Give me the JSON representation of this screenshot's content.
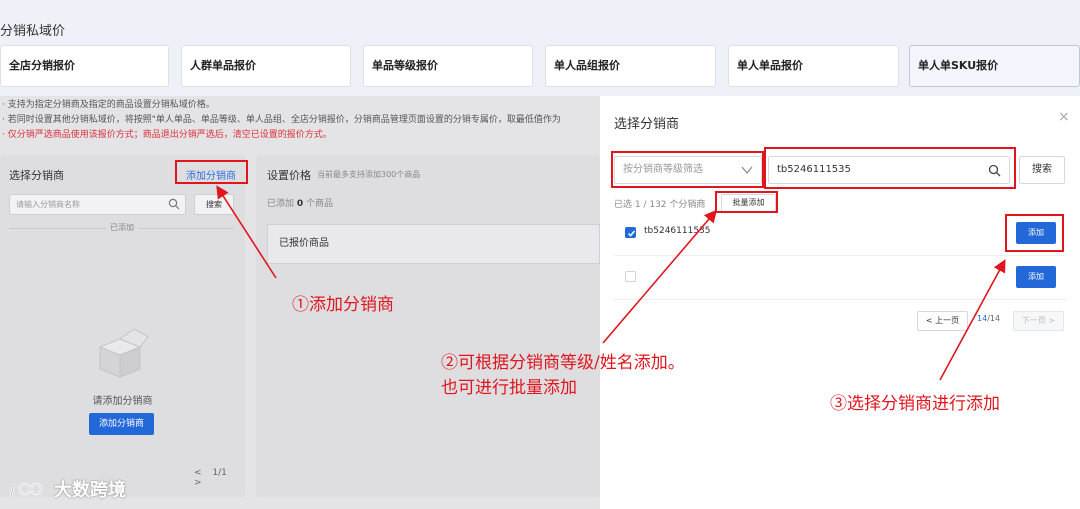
{
  "page": {
    "title": "分销私域价"
  },
  "tabs": [
    {
      "label": "全店分销报价"
    },
    {
      "label": "人群单品报价"
    },
    {
      "label": "单品等级报价"
    },
    {
      "label": "单人品组报价"
    },
    {
      "label": "单人单品报价"
    },
    {
      "label": "单人单SKU报价"
    }
  ],
  "notes": [
    "· 支持为指定分销商及指定的商品设置分销私域价格。",
    "· 若同时设置其他分销私域价，将按照\"单人单品、单品等级、单人品组、全店分销报价，分销商品管理页面设置的分销专属价，取最低值作为",
    "· 仅分销严选商品使用该报价方式；商品退出分销严选后，清空已设置的报价方式。"
  ],
  "left_panel": {
    "title": "选择分销商",
    "add_link": "添加分销商",
    "search_placeholder": "请输入分销商名称",
    "search_button": "搜索",
    "divider_label": "已添加",
    "empty_text": "请添加分销商",
    "add_button": "添加分销商",
    "pager": {
      "prev": "<",
      "page": "1/1",
      "next": ">"
    }
  },
  "mid_panel": {
    "title": "设置价格",
    "subtitle": "当前最多支持添加300个商品",
    "count_prefix": "已添加",
    "count_value": "0",
    "count_suffix": "个商品",
    "table_header": "已报价商品"
  },
  "modal": {
    "title": "选择分销商",
    "close": "×",
    "filter_placeholder": "按分销商等级筛选",
    "search_value": "tb5246111535",
    "search_button": "搜索",
    "selected_text": "已选 1 / 132 个分销商",
    "batch_button": "批量添加",
    "rows": [
      {
        "name": "tb5246111535",
        "checked": true,
        "button": "添加"
      },
      {
        "name": "",
        "checked": false,
        "button": "添加"
      }
    ],
    "pager": {
      "prev": "< 上一页",
      "current": "14",
      "total": "/14",
      "next": "下一页 >"
    }
  },
  "annotations": {
    "step1": "①添加分销商",
    "step2_line1": "②可根据分销商等级/姓名添加。",
    "step2_line2": "也可进行批量添加",
    "step3": "③选择分销商进行添加"
  },
  "watermark": {
    "text": "大数跨境"
  },
  "colors": {
    "primary": "#2268d8",
    "annotation_red": "#e0161e",
    "warning_red": "#d9303b"
  }
}
